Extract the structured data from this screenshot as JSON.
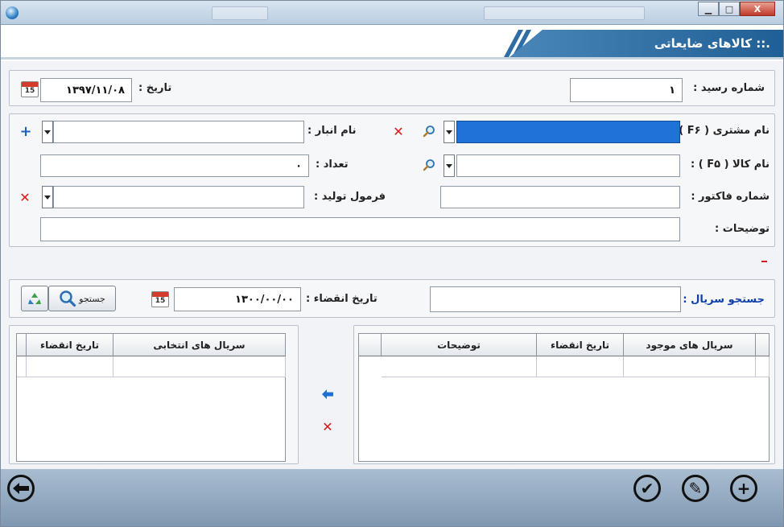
{
  "window": {
    "title": ".:: کالاهای ضایعاتی",
    "controls": {
      "minimize": "▁",
      "maximize": "□",
      "close": "X"
    }
  },
  "receipt": {
    "number_label": "شماره رسید :",
    "number_value": "۱",
    "date_label": "تاریخ :",
    "date_value": "۱۳۹۷/۱۱/۰۸"
  },
  "calendar_icon_text": "15",
  "form": {
    "customer_label": "نام مشتری ( F۶ ) :",
    "customer_value": "",
    "warehouse_label": "نام انبار :",
    "warehouse_value": "",
    "product_label": "نام کالا ( F۵ ) :",
    "product_value": "",
    "quantity_label": "تعداد :",
    "quantity_value": "۰",
    "invoice_label": "شماره فاکتور :",
    "invoice_value": "",
    "formula_label": "فرمول تولید :",
    "formula_value": "",
    "description_label": "توضیحات :",
    "description_value": ""
  },
  "serial_search": {
    "label": "جستجو سریال :",
    "value": "",
    "expiry_label": "تاریخ انقضاء :",
    "expiry_value": "۱۳۰۰/۰۰/۰۰",
    "search_button": "جستجو"
  },
  "available_grid": {
    "columns": [
      "سریال های موجود",
      "تاریخ انقضاء",
      "توضیحات"
    ]
  },
  "selected_grid": {
    "columns": [
      "سریال های انتخابی",
      "تاریخ انقضاء"
    ]
  },
  "colors": {
    "selected_field": "#1f73d8",
    "header_band": "#1f5f95",
    "delete_red": "#d21b1b",
    "label_blue": "#1040a8"
  },
  "icons": {
    "add": "+",
    "delete": "✕",
    "search": "search-icon",
    "move_left": "🡄",
    "check": "✔",
    "edit": "✎",
    "back": "🡐"
  }
}
